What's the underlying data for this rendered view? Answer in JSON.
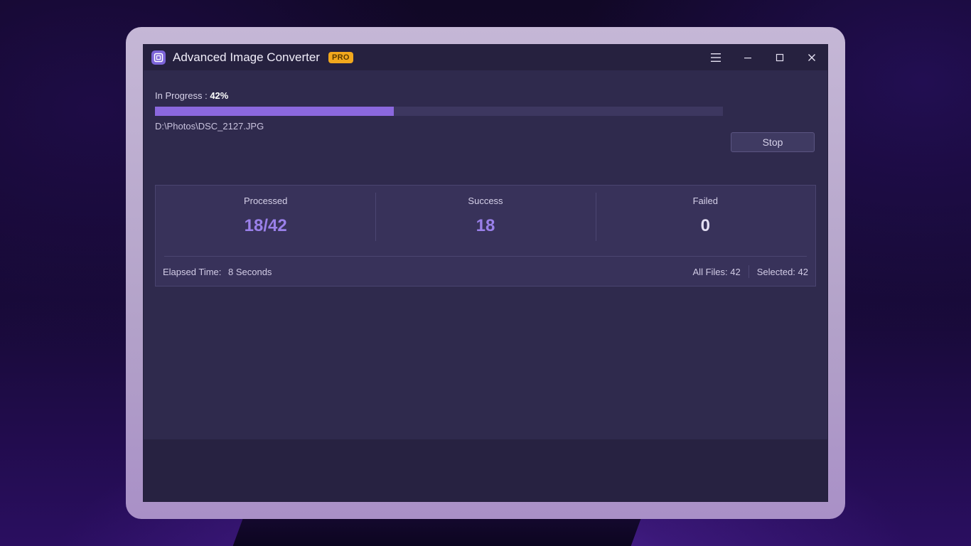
{
  "window": {
    "title": "Advanced Image Converter",
    "badge": "PRO",
    "controls": [
      "menu-icon",
      "minimize-icon",
      "maximize-icon",
      "close-icon"
    ]
  },
  "progress": {
    "label": "In Progress :",
    "percent_text": "42%",
    "percent": 42,
    "current_file": "D:\\Photos\\DSC_2127.JPG",
    "stop_label": "Stop"
  },
  "stats": {
    "processed": {
      "label": "Processed",
      "value": "18/42"
    },
    "success": {
      "label": "Success",
      "value": "18"
    },
    "failed": {
      "label": "Failed",
      "value": "0"
    }
  },
  "footer": {
    "elapsed_label": "Elapsed Time:",
    "elapsed_value": "8 Seconds",
    "all_files": "All Files: 42",
    "selected": "Selected: 42"
  },
  "colors": {
    "accent": "#8b68de",
    "stat_value_accent": "#9a80ea",
    "stat_value_neutral": "#e3def2",
    "badge": "#f2a81d"
  }
}
